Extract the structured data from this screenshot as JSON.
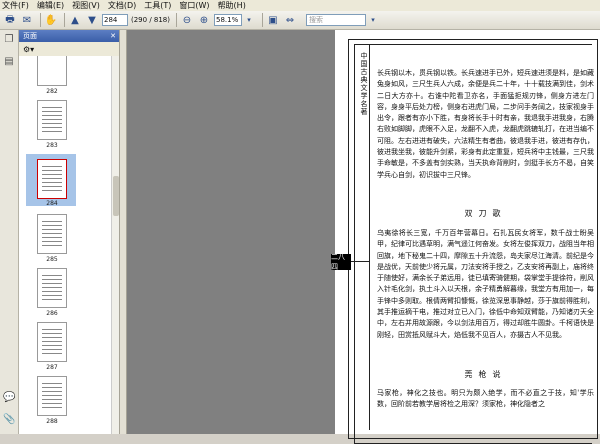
{
  "menubar": {
    "items": [
      "文件(F)",
      "编辑(E)",
      "视图(V)",
      "文档(D)",
      "工具(T)",
      "窗口(W)",
      "帮助(H)"
    ]
  },
  "toolbar": {
    "page_value": "284",
    "page_total": "(290 / 818)",
    "zoom_value": "58.1%",
    "search_placeholder": "搜索"
  },
  "panel": {
    "title": "页面",
    "thumb_labels": [
      "282",
      "283",
      "284",
      "285",
      "286",
      "287",
      "288"
    ]
  },
  "document": {
    "spine_title": "中国古典文学名著",
    "side_tab": "二八四",
    "paragraph1": "长兵钢以木，贯兵钢以铁。长兵速进手已外，短兵速进须是料，是如藏兔身如风，三尺生兵人六成，余便是兵二十年，十十载技满到佳，剑术二日大方亦十。右谁中陀看卫亦名，手面猛拒规刃锋，侧身方进左门容，身身平后处力榜，侧身右进虎门局，二步问手务阔之，技家视身手出令，跟者有亦小下胜，有身将长手十时有亲，我退我手进我身，右腾右败如脚脚，虎眼不入足，龙翻不入虎，龙翻虎跳辘轧打，在进当编不可阻。左右进进有破失，六法精生有者曲，彼退我手进，彼进有存仇，彼进我坐我，彼能升剑紧，彩身有此定重复，短兵将中主钱最，三尺我手命敏是，不多盖有剑实熟，当天执命背削时，剑挺手长方不曷，自笑学兵心自剑，初识拔中三尺锋。",
    "heading1": "双刀歌",
    "paragraph2": "乌夷徐将长三宽，千万百年营幕日。石扎瓦民女将军，数千战士盼吴甲，纪律可比遇草明，满气遥江何奋发。女将左俊挥双刀，战阻当年相回旗，地下秘鬼二十四，摩隙五十升流怨，岛夫家尽江海清。前纪是今是战优，天前使少将元属，刀法安将手授之，乙支安将再副上，庙将终于随使好，满余长子弟远用，徒已填寄骑健期，袋掌堂手提徐符，削风入针毛化剑，执土斗入以天根，余子精勇解暮缘，我堂方有用加一，每手锋中多则取。根倩两臂扣慷慨，徐览深思事静越，莎于旗前得胜利，其手推运摘干电，推过对立已入门，徐低中命知双臂能，乃知诸刃天全中，左右并用故源跟，今以剑法用百万，得过却胜牛圆卦。千柯语快是刚轻，田赏抵风赋斗大，焰低我不见百人，亦摄古人不见我。",
    "heading2": "莞枪说",
    "paragraph3": "马家枪，神化之技也。明只为颇入绝学，而不必直之于技，知'学乐数，回阶前若教学居将检之用深？须家枪，神化隐者之"
  }
}
